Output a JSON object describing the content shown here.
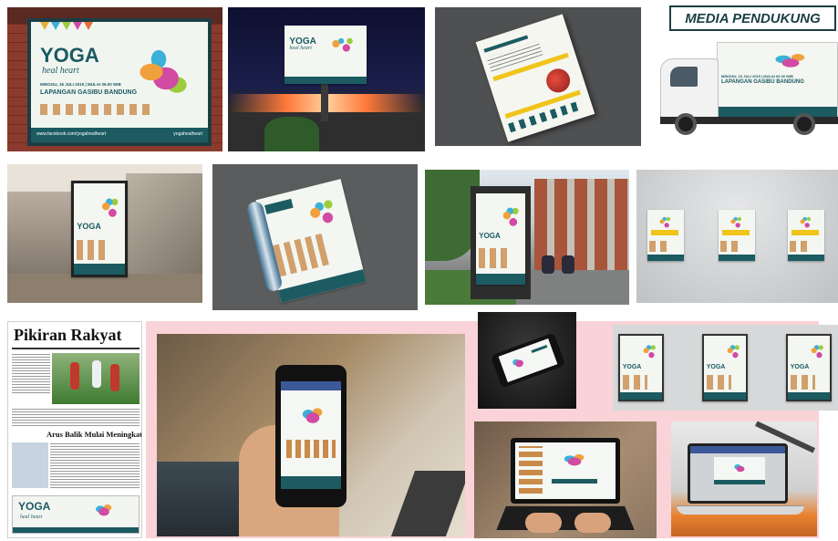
{
  "header": {
    "label": "MEDIA PENDUKUNG"
  },
  "billboard": {
    "title": "YOGA",
    "subtitle": "heal heart",
    "line1": "MINGGU, 16 JULI 2015 | MULAI 06.00 WIB",
    "line2": "LAPANGAN GASIBU BANDUNG",
    "footer_url": "www.facebook.com/yogahealheart",
    "footer_handle": "yogahealheart"
  },
  "truck": {
    "line1": "MINGGU, 16 JULI 2015 | MULAI 06.00 WIB",
    "line2": "LAPANGAN GASIBU BANDUNG"
  },
  "newspaper": {
    "masthead": "Pikiran Rakyat",
    "headline": "Arus Balik Mulai Meningkat",
    "ad_title": "YOGA",
    "ad_subtitle": "heal heart"
  },
  "small_posters": {
    "title": "YOGA",
    "subtitle": "heal heart"
  },
  "colors": {
    "teal": "#1c5b62",
    "pink_bg": "#f9d3d7",
    "wall": "#cfd1d3"
  }
}
